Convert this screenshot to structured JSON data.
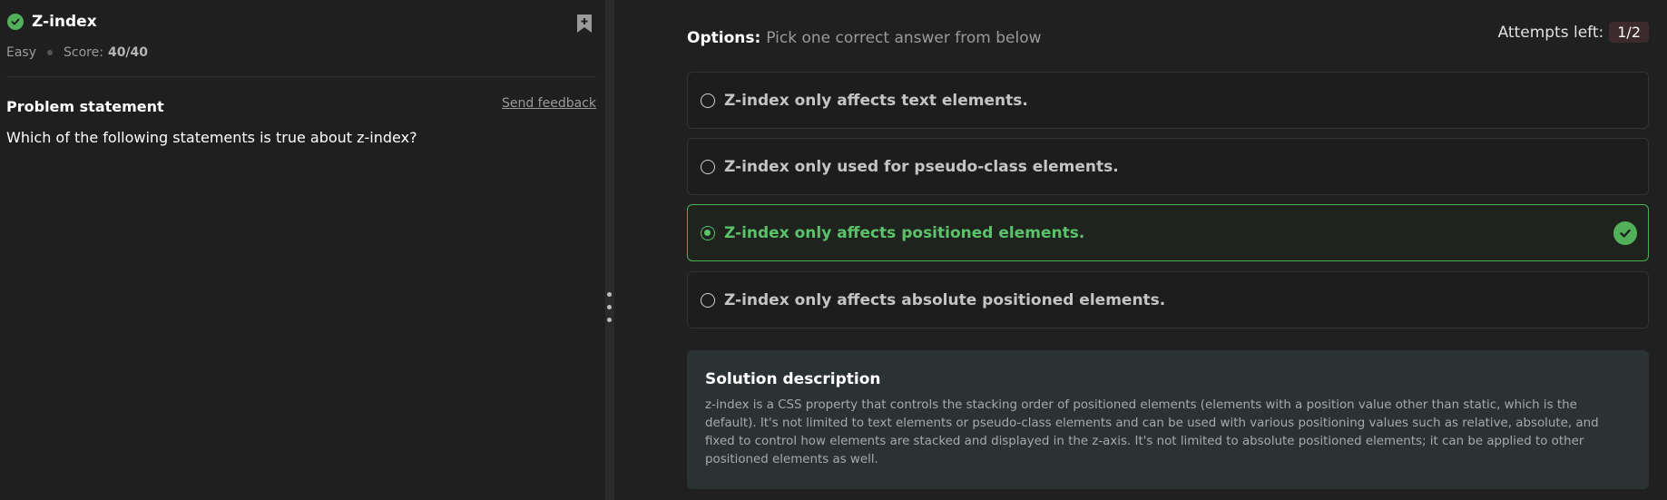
{
  "problem": {
    "title": "Z-index",
    "difficulty": "Easy",
    "score_label": "Score:",
    "score_value": "40/40",
    "statement_label": "Problem statement",
    "feedback_link": "Send feedback",
    "question": "Which of the following statements is true about z-index?",
    "status_icon": "check-circle-icon",
    "bookmark_icon": "bookmark-add-icon"
  },
  "options_panel": {
    "heading_bold": "Options:",
    "heading_rest": "Pick one correct answer from below",
    "attempts_label": "Attempts left:",
    "attempts_value": "1/2",
    "options": [
      {
        "label": "Z-index only affects text elements.",
        "selected": false
      },
      {
        "label": "Z-index only used for pseudo-class elements.",
        "selected": false
      },
      {
        "label": "Z-index only affects positioned elements.",
        "selected": true,
        "correct": true
      },
      {
        "label": "Z-index only affects absolute positioned elements.",
        "selected": false
      }
    ]
  },
  "solution": {
    "title": "Solution description",
    "text": "z-index is a CSS property that controls the stacking order of positioned elements (elements with a position value other than static, which is the default). It's not limited to text elements or pseudo-class elements and can be used with various positioning values such as relative, absolute, and fixed to control how elements are stacked and displayed in the z-axis. It's not limited to absolute positioned elements; it can be applied to other positioned elements as well."
  },
  "colors": {
    "accent_green": "#52b05a",
    "correct_text": "#5cc26a",
    "background": "#202020",
    "solution_bg": "#2b3233",
    "attempts_badge_bg": "#3d2a2c"
  }
}
